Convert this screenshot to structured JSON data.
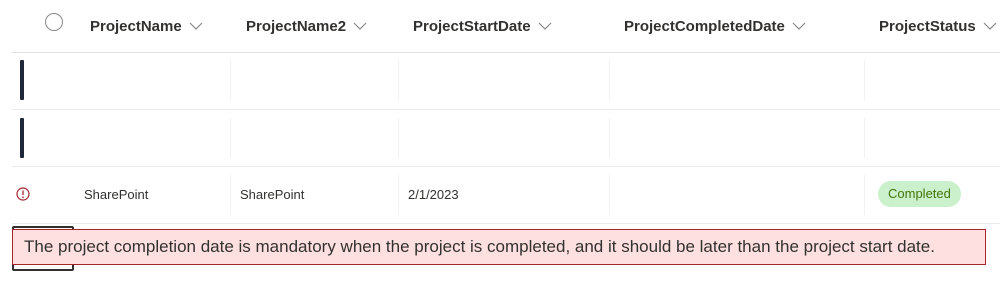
{
  "columns": [
    {
      "label": "ProjectName"
    },
    {
      "label": "ProjectName2"
    },
    {
      "label": "ProjectStartDate"
    },
    {
      "label": "ProjectCompletedDate"
    },
    {
      "label": "ProjectStatus"
    }
  ],
  "rows": [
    {
      "project_name": "",
      "project_name2": "",
      "start_date": "",
      "completed_date": "",
      "status": ""
    },
    {
      "project_name": "",
      "project_name2": "",
      "start_date": "",
      "completed_date": "",
      "status": ""
    },
    {
      "project_name": "SharePoint",
      "project_name2": "SharePoint",
      "start_date": "2/1/2023",
      "completed_date": "",
      "status": "Completed",
      "has_error": true
    }
  ],
  "error": {
    "message": "The project completion date is mandatory when the project is completed, and it should be later than the project start date."
  },
  "icons": {
    "select_all": "circle-icon",
    "sort": "chevron-down-icon",
    "error": "error-circle-icon"
  },
  "colors": {
    "status_badge_bg": "#caf0cc",
    "status_badge_text": "#437406",
    "error_bg": "#fde0df",
    "error_border": "#a4262c",
    "error_icon": "#a4262c",
    "row_marker": "#1f2838"
  }
}
